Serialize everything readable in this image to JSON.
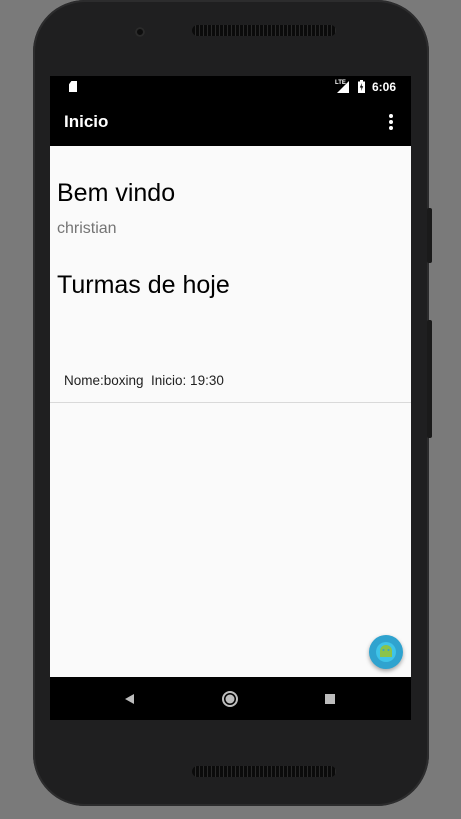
{
  "status_bar": {
    "network_label": "LTE",
    "time": "6:06"
  },
  "app_bar": {
    "title": "Inicio"
  },
  "main": {
    "welcome_title": "Bem vindo",
    "user_name": "christian",
    "section_title": "Turmas de hoje",
    "classes": [
      {
        "text": "Nome:boxing  Inicio: 19:30"
      }
    ]
  },
  "icons": {
    "sd_card": "sd-card-icon",
    "signal": "signal-icon",
    "battery": "battery-charging-icon",
    "overflow": "more-vert-icon",
    "fab": "android-icon",
    "back": "back-triangle-icon",
    "home": "home-circle-icon",
    "recents": "recents-square-icon"
  },
  "colors": {
    "app_bar": "#000000",
    "background": "#fafafa",
    "fab": "#2fa3cf",
    "secondary_text": "#757575"
  }
}
